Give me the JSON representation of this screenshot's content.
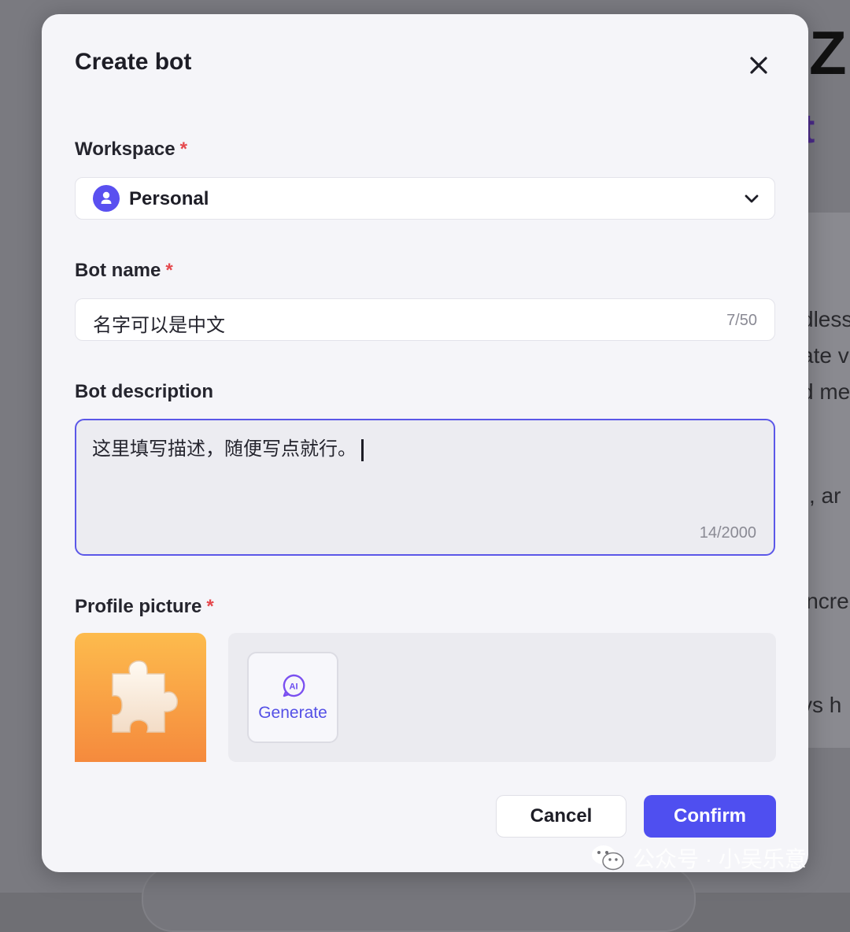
{
  "background": {
    "heading_fragment": "Z",
    "sub_fragment": "t",
    "text_fragments": [
      "dless",
      "ate v",
      "d me",
      "\", ar",
      "incre",
      "ys h"
    ]
  },
  "modal": {
    "title": "Create bot",
    "close_icon": "close-icon"
  },
  "workspace": {
    "label": "Workspace",
    "required_mark": "*",
    "value": "Personal",
    "icon": "user-avatar-icon"
  },
  "bot_name": {
    "label": "Bot name",
    "required_mark": "*",
    "value": "名字可以是中文",
    "counter": "7/50"
  },
  "bot_description": {
    "label": "Bot description",
    "value": "这里填写描述，随便写点就行。",
    "counter": "14/2000"
  },
  "profile_picture": {
    "label": "Profile picture",
    "required_mark": "*",
    "image_icon": "puzzle-piece-icon",
    "generate_label": "Generate",
    "generate_icon": "ai-icon"
  },
  "actions": {
    "cancel_label": "Cancel",
    "confirm_label": "Confirm"
  },
  "watermark": {
    "text": "公众号 · 小吴乐意"
  },
  "colors": {
    "accent": "#4f4ff0",
    "required": "#e5484d",
    "tile_top": "#fdbb4d",
    "tile_bottom": "#f58a3d"
  }
}
